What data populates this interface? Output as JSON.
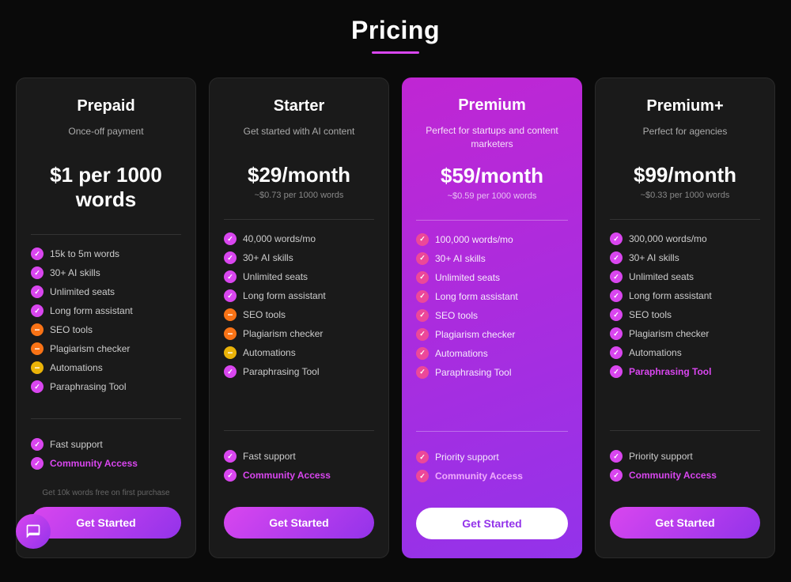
{
  "page": {
    "title": "Pricing",
    "title_underline_color": "#d946ef"
  },
  "cards": [
    {
      "id": "prepaid",
      "title": "Prepaid",
      "subtitle": "Once-off payment",
      "price": "$1 per 1000 words",
      "price_per": "",
      "features": [
        {
          "text": "15k to 5m words",
          "icon": "check-purple"
        },
        {
          "text": "30+ AI skills",
          "icon": "check-purple"
        },
        {
          "text": "Unlimited seats",
          "icon": "check-purple"
        },
        {
          "text": "Long form assistant",
          "icon": "check-purple"
        },
        {
          "text": "SEO tools",
          "icon": "minus-orange"
        },
        {
          "text": "Plagiarism checker",
          "icon": "minus-orange"
        },
        {
          "text": "Automations",
          "icon": "minus-yellow"
        },
        {
          "text": "Paraphrasing Tool",
          "icon": "check-purple"
        }
      ],
      "support_features": [
        {
          "text": "Fast support",
          "icon": "check-purple"
        },
        {
          "text": "Community Access",
          "icon": "check-purple",
          "highlight": true
        }
      ],
      "free_note": "Get 10k words free on first purchase",
      "button_label": "Get Started",
      "is_premium": false
    },
    {
      "id": "starter",
      "title": "Starter",
      "subtitle": "Get started with AI content",
      "price": "$29/month",
      "price_per": "~$0.73 per 1000 words",
      "features": [
        {
          "text": "40,000 words/mo",
          "icon": "check-purple"
        },
        {
          "text": "30+ AI skills",
          "icon": "check-purple"
        },
        {
          "text": "Unlimited seats",
          "icon": "check-purple"
        },
        {
          "text": "Long form assistant",
          "icon": "check-purple"
        },
        {
          "text": "SEO tools",
          "icon": "minus-orange"
        },
        {
          "text": "Plagiarism checker",
          "icon": "minus-orange"
        },
        {
          "text": "Automations",
          "icon": "minus-yellow"
        },
        {
          "text": "Paraphrasing Tool",
          "icon": "check-purple"
        }
      ],
      "support_features": [
        {
          "text": "Fast support",
          "icon": "check-purple"
        },
        {
          "text": "Community Access",
          "icon": "check-purple",
          "highlight": true
        }
      ],
      "free_note": "",
      "button_label": "Get Started",
      "is_premium": false
    },
    {
      "id": "premium",
      "title": "Premium",
      "subtitle": "Perfect for startups and content marketers",
      "price": "$59/month",
      "price_per": "~$0.59 per 1000 words",
      "features": [
        {
          "text": "100,000 words/mo",
          "icon": "check-pink"
        },
        {
          "text": "30+ AI skills",
          "icon": "check-pink"
        },
        {
          "text": "Unlimited seats",
          "icon": "check-pink"
        },
        {
          "text": "Long form assistant",
          "icon": "check-pink"
        },
        {
          "text": "SEO tools",
          "icon": "check-pink"
        },
        {
          "text": "Plagiarism checker",
          "icon": "check-pink"
        },
        {
          "text": "Automations",
          "icon": "check-pink"
        },
        {
          "text": "Paraphrasing Tool",
          "icon": "check-pink"
        }
      ],
      "support_features": [
        {
          "text": "Priority support",
          "icon": "check-pink"
        },
        {
          "text": "Community Access",
          "icon": "check-pink",
          "highlight": true
        }
      ],
      "free_note": "",
      "button_label": "Get Started",
      "is_premium": true
    },
    {
      "id": "premium-plus",
      "title": "Premium+",
      "subtitle": "Perfect for agencies",
      "price": "$99/month",
      "price_per": "~$0.33 per 1000 words",
      "features": [
        {
          "text": "300,000 words/mo",
          "icon": "check-purple"
        },
        {
          "text": "30+ AI skills",
          "icon": "check-purple"
        },
        {
          "text": "Unlimited seats",
          "icon": "check-purple"
        },
        {
          "text": "Long form assistant",
          "icon": "check-purple"
        },
        {
          "text": "SEO tools",
          "icon": "check-purple"
        },
        {
          "text": "Plagiarism checker",
          "icon": "check-purple"
        },
        {
          "text": "Automations",
          "icon": "check-purple"
        },
        {
          "text": "Paraphrasing Tool",
          "icon": "check-purple",
          "highlight": true
        }
      ],
      "support_features": [
        {
          "text": "Priority support",
          "icon": "check-purple"
        },
        {
          "text": "Community Access",
          "icon": "check-purple",
          "highlight": true
        }
      ],
      "free_note": "",
      "button_label": "Get Started",
      "is_premium": false
    }
  ],
  "chat": {
    "label": "Chat support"
  }
}
